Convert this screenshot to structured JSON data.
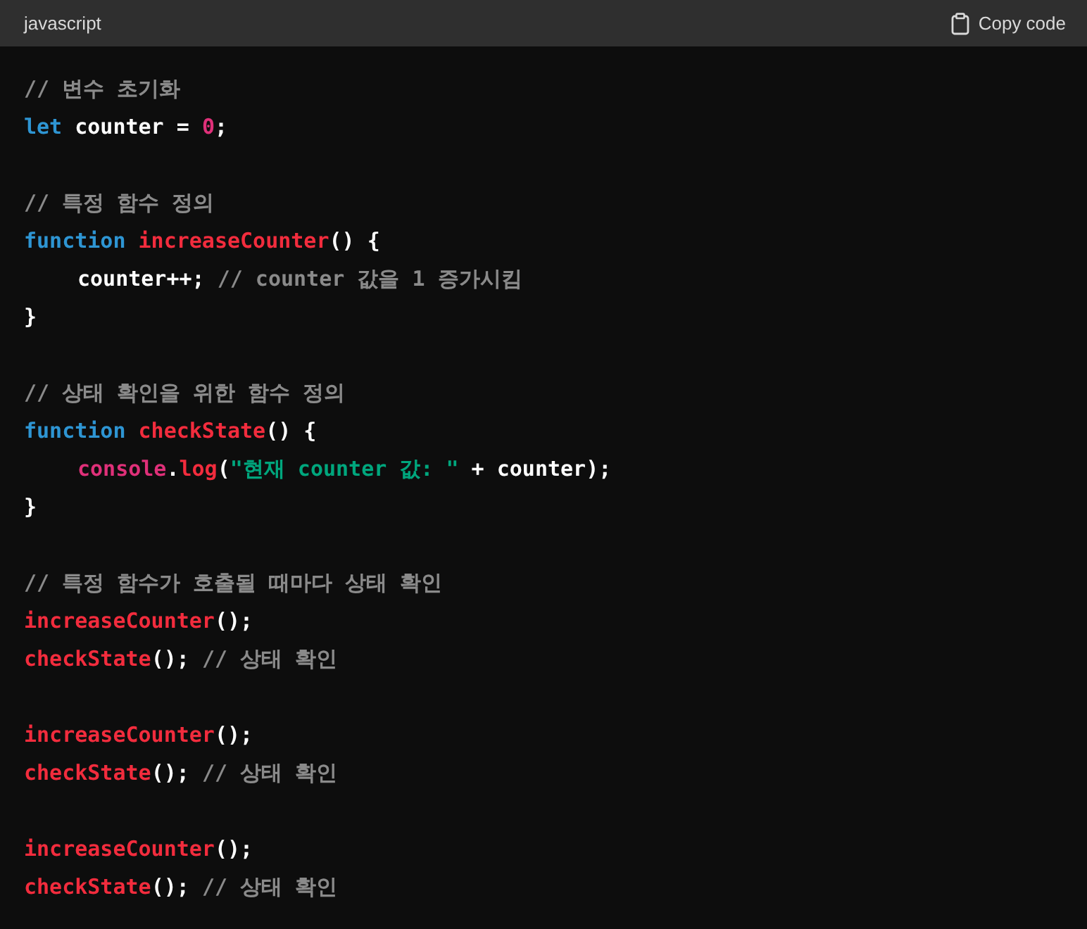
{
  "header": {
    "language": "javascript",
    "copy_button": "Copy code"
  },
  "lines": [
    {
      "kind": "code",
      "tokens": [
        {
          "kind": "comment",
          "text": "// 변수 초기화"
        }
      ]
    },
    {
      "kind": "code",
      "tokens": [
        {
          "kind": "keyword",
          "text": "let"
        },
        {
          "kind": "plain",
          "text": " counter = "
        },
        {
          "kind": "number",
          "text": "0"
        },
        {
          "kind": "plain",
          "text": ";"
        }
      ]
    },
    {
      "kind": "blank"
    },
    {
      "kind": "code",
      "tokens": [
        {
          "kind": "comment",
          "text": "// 특정 함수 정의"
        }
      ]
    },
    {
      "kind": "code",
      "tokens": [
        {
          "kind": "keyword",
          "text": "function "
        },
        {
          "kind": "function",
          "text": "increaseCounter"
        },
        {
          "kind": "plain",
          "text": "() {"
        }
      ],
      "children": [
        {
          "kind": "code",
          "tokens": [
            {
              "kind": "plain",
              "text": "counter++; "
            },
            {
              "kind": "comment",
              "text": "// counter 값을 1 증가시킴"
            }
          ]
        }
      ]
    },
    {
      "kind": "code",
      "tokens": [
        {
          "kind": "plain",
          "text": "}"
        }
      ]
    },
    {
      "kind": "blank"
    },
    {
      "kind": "code",
      "tokens": [
        {
          "kind": "comment",
          "text": "// 상태 확인을 위한 함수 정의"
        }
      ]
    },
    {
      "kind": "code",
      "tokens": [
        {
          "kind": "keyword",
          "text": "function "
        },
        {
          "kind": "function",
          "text": "checkState"
        },
        {
          "kind": "plain",
          "text": "() {"
        }
      ],
      "children": [
        {
          "kind": "code",
          "tokens": [
            {
              "kind": "builtin",
              "text": "console"
            },
            {
              "kind": "plain",
              "text": "."
            },
            {
              "kind": "function",
              "text": "log"
            },
            {
              "kind": "plain",
              "text": "("
            },
            {
              "kind": "string",
              "text": "\"현재 counter 값: \""
            },
            {
              "kind": "plain",
              "text": " + counter);"
            }
          ]
        }
      ]
    },
    {
      "kind": "code",
      "tokens": [
        {
          "kind": "plain",
          "text": "}"
        }
      ]
    },
    {
      "kind": "blank"
    },
    {
      "kind": "code",
      "tokens": [
        {
          "kind": "comment",
          "text": "// 특정 함수가 호출될 때마다 상태 확인"
        }
      ]
    },
    {
      "kind": "code",
      "tokens": [
        {
          "kind": "function",
          "text": "increaseCounter"
        },
        {
          "kind": "plain",
          "text": "();"
        }
      ]
    },
    {
      "kind": "code",
      "tokens": [
        {
          "kind": "function",
          "text": "checkState"
        },
        {
          "kind": "plain",
          "text": "(); "
        },
        {
          "kind": "comment",
          "text": "// 상태 확인"
        }
      ]
    },
    {
      "kind": "blank"
    },
    {
      "kind": "code",
      "tokens": [
        {
          "kind": "function",
          "text": "increaseCounter"
        },
        {
          "kind": "plain",
          "text": "();"
        }
      ]
    },
    {
      "kind": "code",
      "tokens": [
        {
          "kind": "function",
          "text": "checkState"
        },
        {
          "kind": "plain",
          "text": "(); "
        },
        {
          "kind": "comment",
          "text": "// 상태 확인"
        }
      ]
    },
    {
      "kind": "blank"
    },
    {
      "kind": "code",
      "tokens": [
        {
          "kind": "function",
          "text": "increaseCounter"
        },
        {
          "kind": "plain",
          "text": "();"
        }
      ]
    },
    {
      "kind": "code",
      "tokens": [
        {
          "kind": "function",
          "text": "checkState"
        },
        {
          "kind": "plain",
          "text": "(); "
        },
        {
          "kind": "comment",
          "text": "// 상태 확인"
        }
      ]
    }
  ]
}
